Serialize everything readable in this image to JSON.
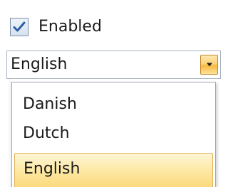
{
  "checkbox": {
    "label": "Enabled",
    "checked": true
  },
  "language_select": {
    "selected_value": "English",
    "arrow_icon": "chevron-down-icon",
    "options": [
      "Danish",
      "Dutch",
      "English"
    ],
    "highlighted_option": "English"
  },
  "colors": {
    "checkmark": "#2b5fa8",
    "highlight": "#fde8a4",
    "arrow_button": "#f7b941"
  }
}
